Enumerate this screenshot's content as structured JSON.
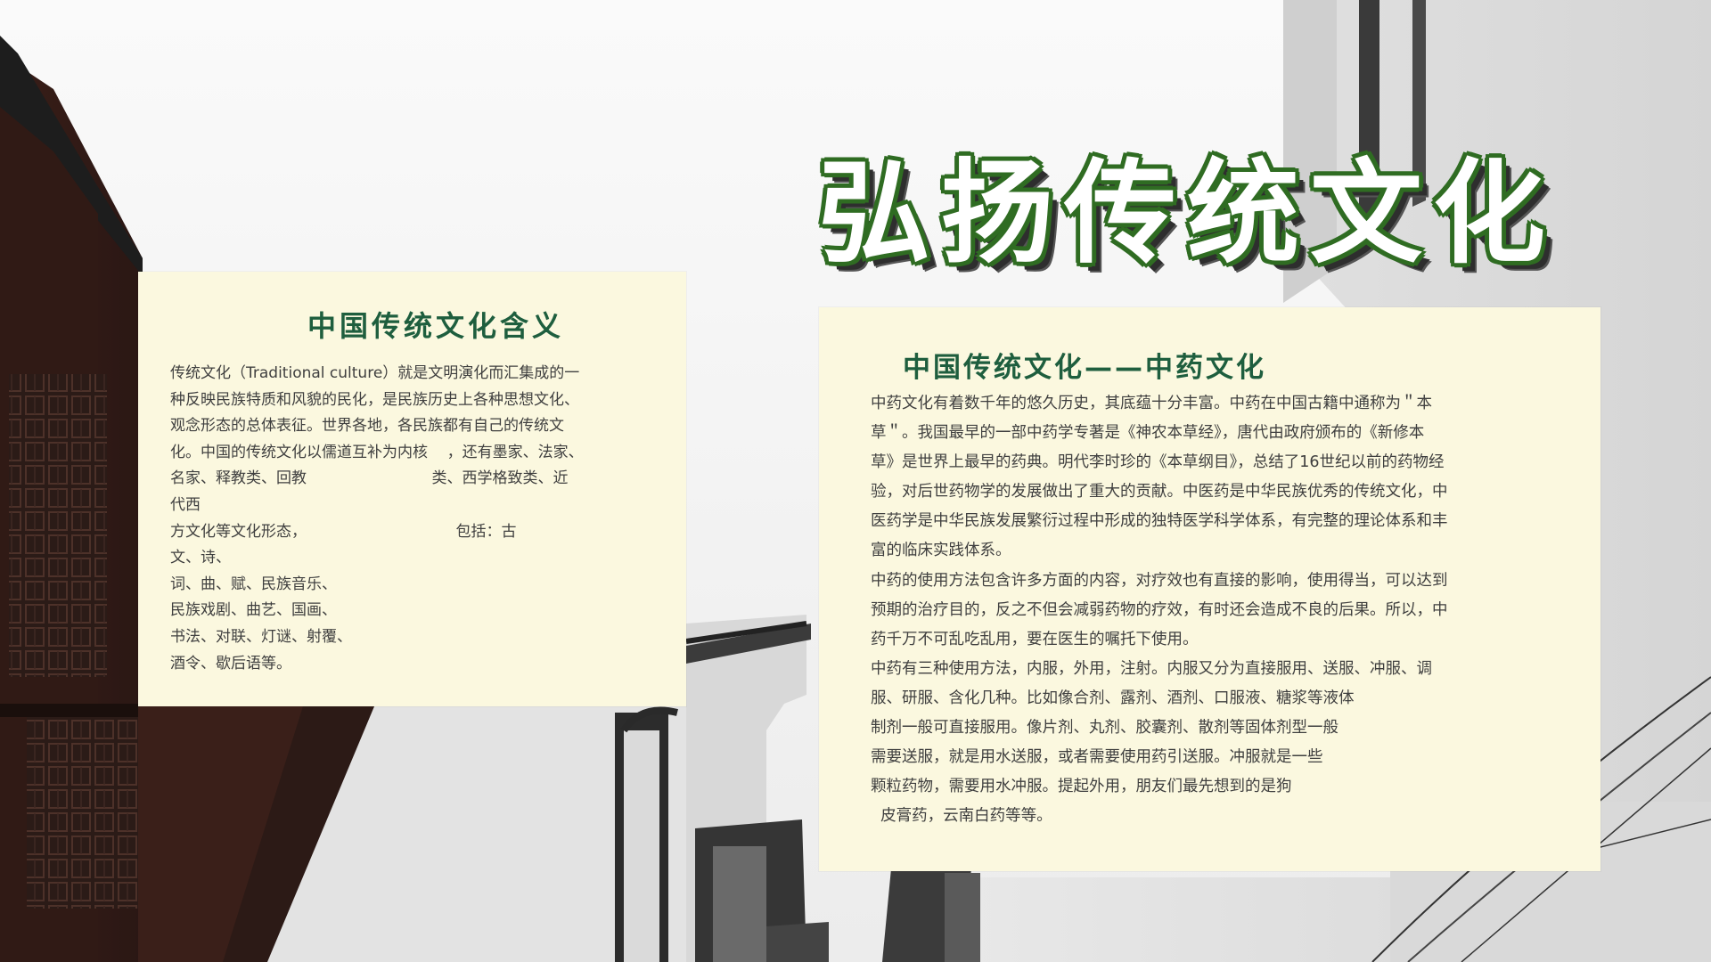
{
  "page": {
    "title": "弘扬传统文化"
  },
  "cards": {
    "left": {
      "title": "中国传统文化含义",
      "lines": [
        "传统文化（Traditional culture）就是文明演化而汇集成的一",
        "种反映民族特质和风貌的民化，是民族历史上各种思想文化、",
        "观念形态的总体表征。世界各地，各民族都有自己的传统文",
        "化。中国的传统文化以儒道互补为内核    ，还有墨家、法家、",
        "名家、释教类、回教                          类、西学格致类、近",
        "代西",
        "方文化等文化形态，                               包括：古",
        "文、诗、",
        "词、曲、赋、民族音乐、",
        "民族戏剧、曲艺、国画、",
        "书法、对联、灯谜、射覆、",
        "酒令、歇后语等。"
      ]
    },
    "right": {
      "title": "中国传统文化——中药文化",
      "lines": [
        "中药文化有着数千年的悠久历史，其底蕴十分丰富。中药在中国古籍中通称为＂本",
        "草＂。我国最早的一部中药学专著是《神农本草经》，唐代由政府颁布的《新修本",
        "草》是世界上最早的药典。明代李时珍的《本草纲目》，总结了16世纪以前的药物经",
        "验，对后世药物学的发展做出了重大的贡献。中医药是中华民族优秀的传统文化，中",
        "医药学是中华民族发展繁衍过程中形成的独特医学科学体系，有完整的理论体系和丰",
        "富的临床实践体系。",
        "中药的使用方法包含许多方面的内容，对疗效也有直接的影响，使用得当，可以达到",
        "预期的治疗目的，反之不但会减弱药物的疗效，有时还会造成不良的后果。所以，中",
        "药千万不可乱吃乱用，要在医生的嘱托下使用。",
        "中药有三种使用方法，内服，外用，注射。内服又分为直接服用、送服、冲服、调",
        "服、研服、含化几种。比如像合剂、露剂、酒剂、口服液、糖浆等液体",
        "制剂一般可直接服用。像片剂、丸剂、胶囊剂、散剂等固体剂型一般",
        "需要送服，就是用水送服，或者需要使用药引送服。冲服就是一些",
        "颗粒药物，需要用水冲服。提起外用，朋友们最先想到的是狗",
        "  皮膏药，云南白药等等。"
      ]
    }
  },
  "colors": {
    "card_background": "#fbf8df",
    "title_green": "#2f6c22",
    "heading_green": "#1e5e3e",
    "body_text": "#3f3f3f"
  }
}
